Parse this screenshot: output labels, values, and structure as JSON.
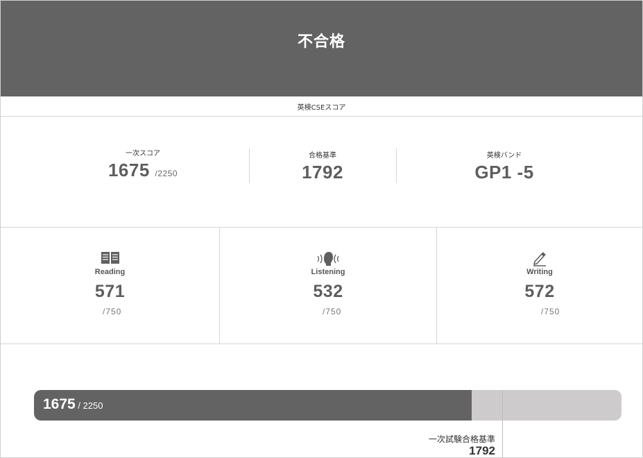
{
  "result": {
    "title": "不合格"
  },
  "cse": {
    "section_label": "英検CSEスコア"
  },
  "summary": {
    "first_score": {
      "label": "一次スコア",
      "value": "1675",
      "max": "/2250"
    },
    "pass_standard": {
      "label": "合格基準",
      "value": "1792"
    },
    "band": {
      "label": "英検バンド",
      "value": "GP1 -5"
    }
  },
  "skills": [
    {
      "name": "Reading",
      "icon": "book-icon",
      "score": "571",
      "max": "/750"
    },
    {
      "name": "Listening",
      "icon": "listening-icon",
      "score": "532",
      "max": "/750"
    },
    {
      "name": "Writing",
      "icon": "pencil-icon",
      "score": "572",
      "max": "/750"
    }
  ],
  "progress": {
    "score": "1675",
    "max_label": " / 2250",
    "value": 1675,
    "total": 2250,
    "threshold_label": "一次試験合格基準",
    "threshold_value": "1792"
  },
  "colors": {
    "header_bg": "#636363",
    "bar_fill": "#636363",
    "bar_track": "#cdcbcb"
  }
}
